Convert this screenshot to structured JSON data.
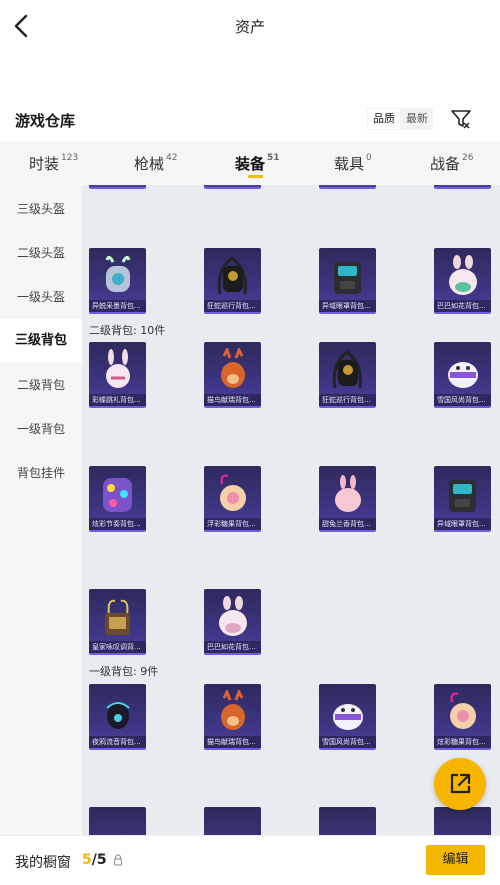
{
  "topbar": {
    "title": "资产"
  },
  "header": {
    "title": "游戏仓库",
    "sort_options": [
      "品质",
      "最新"
    ]
  },
  "tabs": [
    {
      "label": "时装",
      "count": "123"
    },
    {
      "label": "枪械",
      "count": "42"
    },
    {
      "label": "装备",
      "count": "51"
    },
    {
      "label": "载具",
      "count": "0"
    },
    {
      "label": "战备",
      "count": "26"
    }
  ],
  "sidebar": {
    "items": [
      "三级头盔",
      "二级头盔",
      "一级头盔",
      "三级背包",
      "二级背包",
      "一级背包",
      "背包挂件"
    ],
    "active": "三级背包"
  },
  "groups": {
    "level2": "二级背包: 10件",
    "level1": "一级背包: 9件"
  },
  "items": {
    "row1": [
      "异蜕采墨背包...",
      "狂蛇巡行背包...",
      "异域眼罩背包...",
      "巴巴如花背包..."
    ],
    "row2": [
      "彩蝶跳礼背包...",
      "猫鸟献瑞背包...",
      "狂蛇巡行背包...",
      "雪国风尚背包..."
    ],
    "row3": [
      "炫彩节奏背包...",
      "浮彩糖果背包...",
      "甜兔兰香背包...",
      "异域眼罩背包..."
    ],
    "row4": [
      "皇家咏叹调背...",
      "巴巴如花背包..."
    ],
    "row5": [
      "夜鸦流音背包...",
      "猫鸟献瑞背包...",
      "雪国风尚背包...",
      "炫彩糖果背包..."
    ]
  },
  "bottom": {
    "label": "我的橱窗",
    "current": "5",
    "total": "/5",
    "edit": "编辑"
  },
  "colors": {
    "accent": "#f5b800",
    "item_bg": "#3c3480"
  }
}
